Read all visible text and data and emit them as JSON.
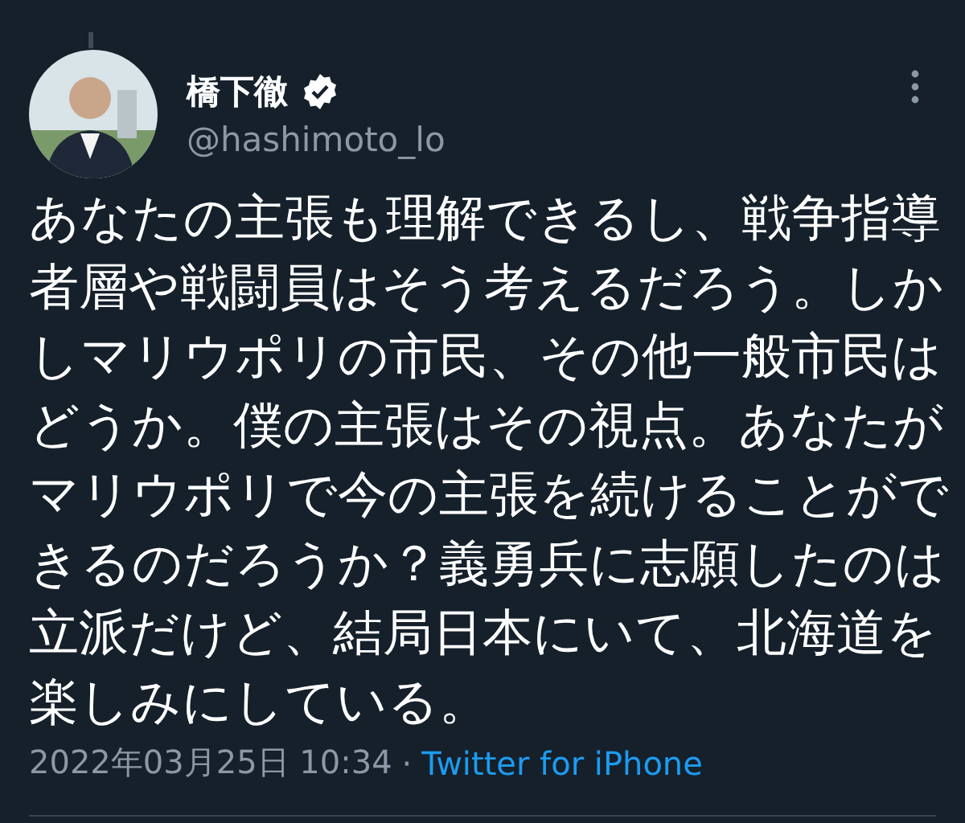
{
  "tweet": {
    "author": {
      "name": "橋下徹",
      "verified": true,
      "handle": "@hashimoto_lo"
    },
    "text": "あなたの主張も理解できるし、戦争指導者層や戦闘員はそう考えるだろう。しかしマリウポリの市民、その他一般市民はどうか。僕の主張はその視点。あなたがマリウポリで今の主張を続けることができるのだろうか？義勇兵に志願したのは立派だけど、結局日本にいて、北海道を楽しみにしている。",
    "timestamp": "2022年03月25日 10:34",
    "separator": "·",
    "source": "Twitter for iPhone"
  }
}
